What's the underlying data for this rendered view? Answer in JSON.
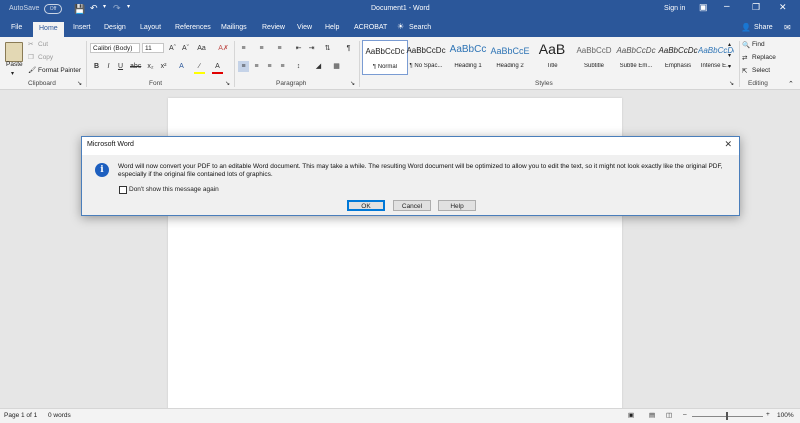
{
  "titlebar": {
    "autosave": "AutoSave",
    "autosave_state": "Off",
    "title": "Document1  -  Word",
    "signin": "Sign in"
  },
  "tabs": [
    "File",
    "Home",
    "Insert",
    "Design",
    "Layout",
    "References",
    "Mailings",
    "Review",
    "View",
    "Help",
    "ACROBAT"
  ],
  "tell_me": "Search",
  "share": "Share",
  "clipboard": {
    "paste": "Paste",
    "cut": "Cut",
    "copy": "Copy",
    "format_painter": "Format Painter",
    "label": "Clipboard"
  },
  "font": {
    "name": "Calibri (Body)",
    "size": "11",
    "label": "Font"
  },
  "paragraph": {
    "label": "Paragraph"
  },
  "styles": {
    "label": "Styles",
    "items": [
      {
        "preview": "AaBbCcDc",
        "name": "¶ Normal"
      },
      {
        "preview": "AaBbCcDc",
        "name": "¶ No Spac..."
      },
      {
        "preview": "AaBbCc",
        "name": "Heading 1"
      },
      {
        "preview": "AaBbCcE",
        "name": "Heading 2"
      },
      {
        "preview": "AaB",
        "name": "Title"
      },
      {
        "preview": "AaBbCcD",
        "name": "Subtitle"
      },
      {
        "preview": "AaBbCcDc",
        "name": "Subtle Em..."
      },
      {
        "preview": "AaBbCcDc",
        "name": "Emphasis"
      },
      {
        "preview": "AaBbCcDc",
        "name": "Intense E..."
      }
    ]
  },
  "editing": {
    "find": "Find",
    "replace": "Replace",
    "select": "Select",
    "label": "Editing"
  },
  "status": {
    "page": "Page 1 of 1",
    "words": "0 words",
    "zoom": "100%"
  },
  "dialog": {
    "title": "Microsoft Word",
    "message": "Word will now convert your PDF to an editable Word document. This may take a while. The resulting Word document will be optimized to allow you to edit the text, so it might not look exactly like the original PDF, especially if the original file contained lots of graphics.",
    "checkbox": "Don't show this message again",
    "ok": "OK",
    "cancel": "Cancel",
    "help": "Help"
  }
}
